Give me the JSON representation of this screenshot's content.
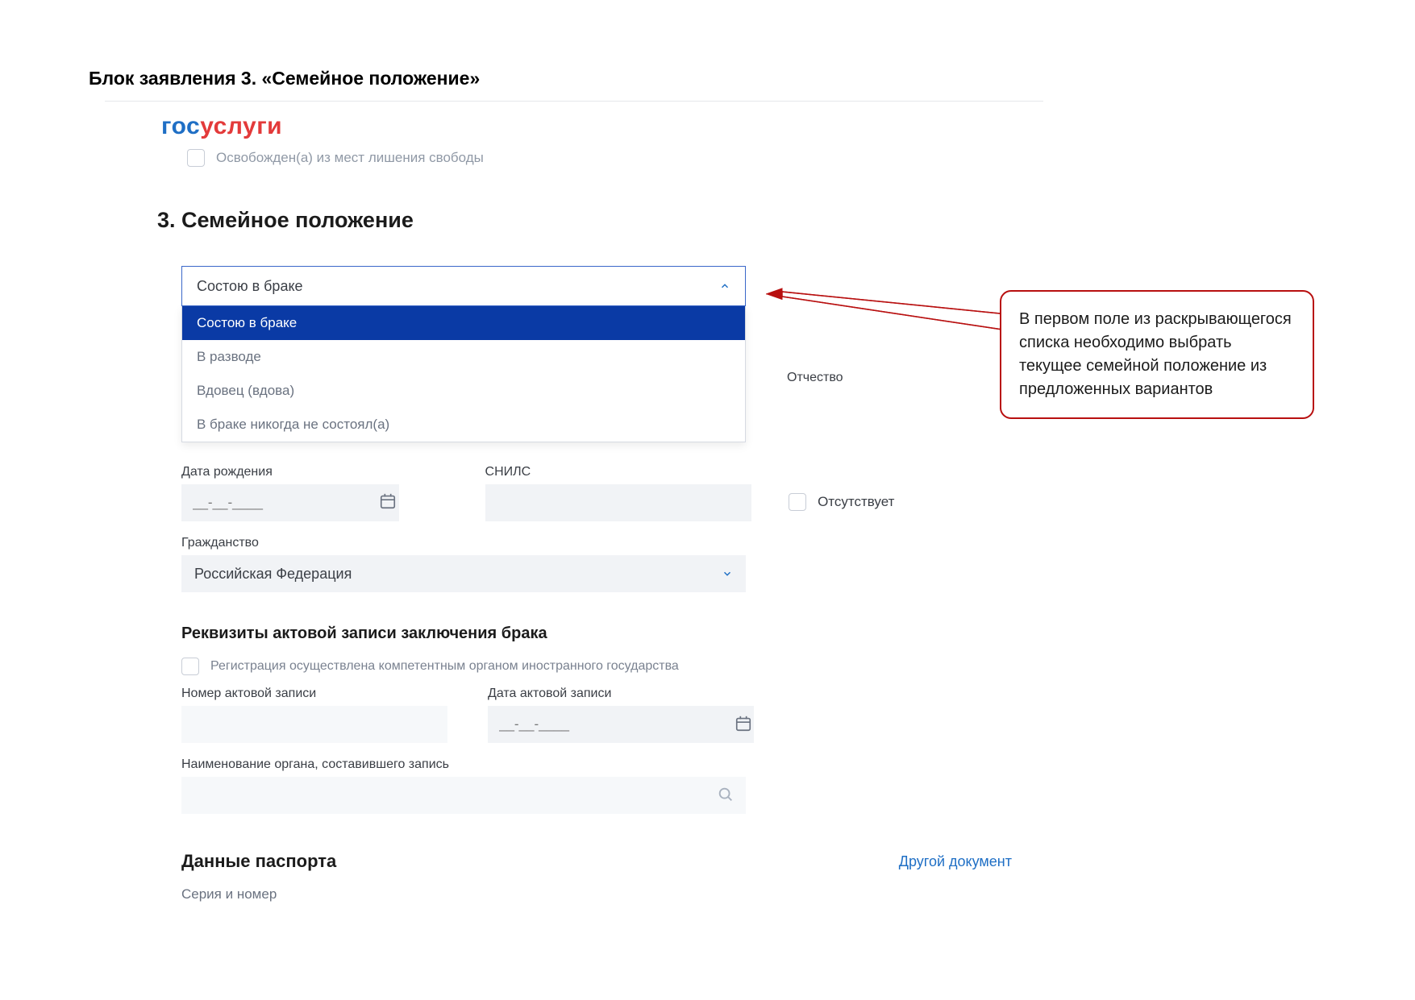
{
  "doc": {
    "title": "Блок заявления 3. «Семейное положение»"
  },
  "logo": {
    "part1": "гос",
    "part2": "услуги"
  },
  "prevCheckbox": {
    "label": "Освобожден(а) из мест лишения свободы"
  },
  "section": {
    "title": "3. Семейное положение"
  },
  "maritalDropdown": {
    "selected": "Состою в браке",
    "options": [
      "Состою в браке",
      "В разводе",
      "Вдовец (вдова)",
      "В браке никогда не состоял(а)"
    ]
  },
  "fields": {
    "patronymic": "Отчество",
    "absentCheckbox": "Отсутствует",
    "dobLabel": "Дата рождения",
    "dobPlaceholder": "__-__-____",
    "snilsLabel": "СНИЛС",
    "citizenshipLabel": "Гражданство",
    "citizenshipValue": "Российская Федерация"
  },
  "marriageRecord": {
    "heading": "Реквизиты актовой записи заключения брака",
    "foreignReg": "Регистрация осуществлена компетентным органом иностранного государства",
    "recordNumberLabel": "Номер актовой записи",
    "recordDateLabel": "Дата актовой записи",
    "recordDatePlaceholder": "__-__-____",
    "authorityLabel": "Наименование органа, составившего запись"
  },
  "passport": {
    "heading": "Данные паспорта",
    "otherDoc": "Другой документ",
    "seriesLabel": "Серия и номер"
  },
  "callout": {
    "text": "В первом поле из раскрывающегося списка необходимо выбрать текущее семейной положение из предложенных вариантов"
  }
}
